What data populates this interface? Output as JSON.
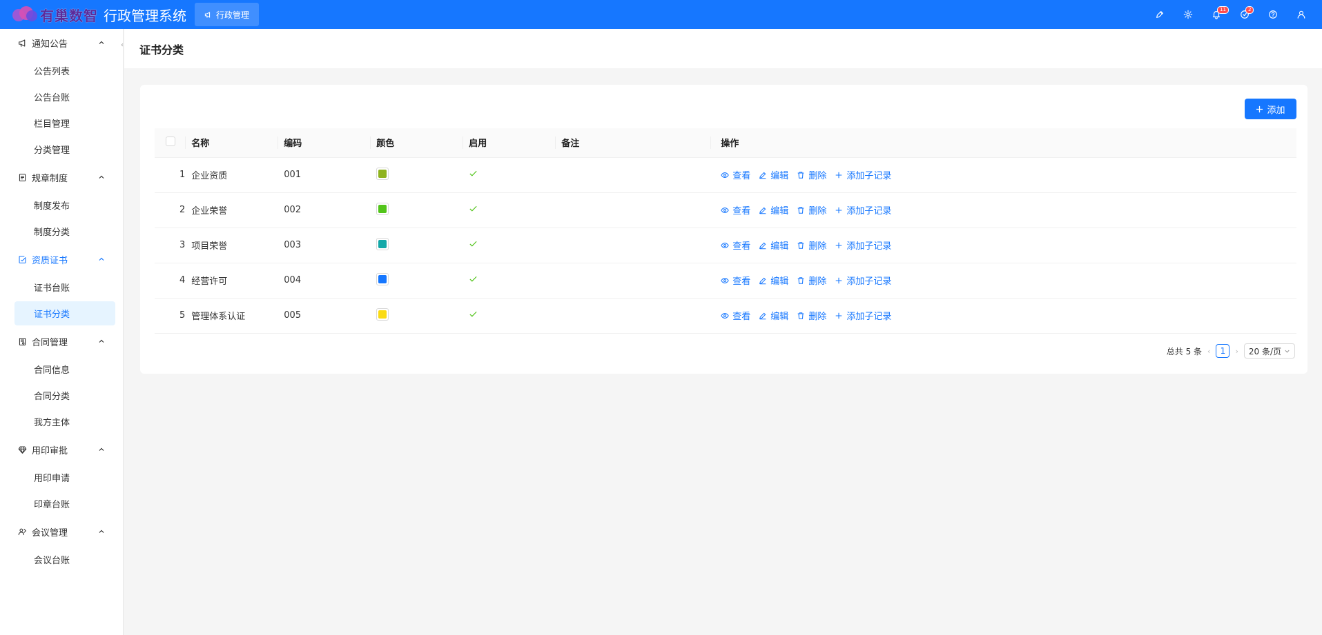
{
  "header": {
    "logo_text": "有巢数智",
    "app_title": "行政管理系统",
    "module_tab": "行政管理",
    "icons": [
      {
        "name": "pen-icon"
      },
      {
        "name": "gear-icon"
      },
      {
        "name": "bell-icon",
        "badge": "11"
      },
      {
        "name": "task-icon",
        "badge": "2"
      },
      {
        "name": "help-icon"
      },
      {
        "name": "user-icon"
      }
    ]
  },
  "sidebar": {
    "groups": [
      {
        "label": "通知公告",
        "icon": "megaphone-icon",
        "items": [
          "公告列表",
          "公告台账",
          "栏目管理",
          "分类管理"
        ]
      },
      {
        "label": "规章制度",
        "icon": "doc-icon",
        "items": [
          "制度发布",
          "制度分类"
        ]
      },
      {
        "label": "资质证书",
        "icon": "certificate-icon",
        "items": [
          "证书台账",
          "证书分类"
        ]
      },
      {
        "label": "合同管理",
        "icon": "contract-icon",
        "items": [
          "合同信息",
          "合同分类",
          "我方主体"
        ]
      },
      {
        "label": "用印审批",
        "icon": "seal-icon",
        "items": [
          "用印申请",
          "印章台账"
        ]
      },
      {
        "label": "会议管理",
        "icon": "meeting-icon",
        "items": [
          "会议台账"
        ]
      }
    ],
    "active_group": "资质证书",
    "active_item": "证书分类"
  },
  "page": {
    "title": "证书分类",
    "add_label": "添加"
  },
  "table": {
    "columns": [
      "名称",
      "编码",
      "颜色",
      "启用",
      "备注",
      "操作"
    ],
    "rows": [
      {
        "index": "1",
        "name": "企业资质",
        "code": "001",
        "color": "#8fb31f",
        "enabled": true,
        "note": ""
      },
      {
        "index": "2",
        "name": "企业荣誉",
        "code": "002",
        "color": "#52c41a",
        "enabled": true,
        "note": ""
      },
      {
        "index": "3",
        "name": "项目荣誉",
        "code": "003",
        "color": "#13a8a8",
        "enabled": true,
        "note": ""
      },
      {
        "index": "4",
        "name": "经营许可",
        "code": "004",
        "color": "#1677ff",
        "enabled": true,
        "note": ""
      },
      {
        "index": "5",
        "name": "管理体系认证",
        "code": "005",
        "color": "#fadb14",
        "enabled": true,
        "note": ""
      }
    ],
    "actions": {
      "view": "查看",
      "edit": "编辑",
      "delete": "删除",
      "add_child": "添加子记录"
    }
  },
  "pagination": {
    "total_text": "总共 5 条",
    "current_page": "1",
    "page_size": "20 条/页"
  },
  "colors": {
    "primary": "#1677ff",
    "check": "#52c41a"
  }
}
